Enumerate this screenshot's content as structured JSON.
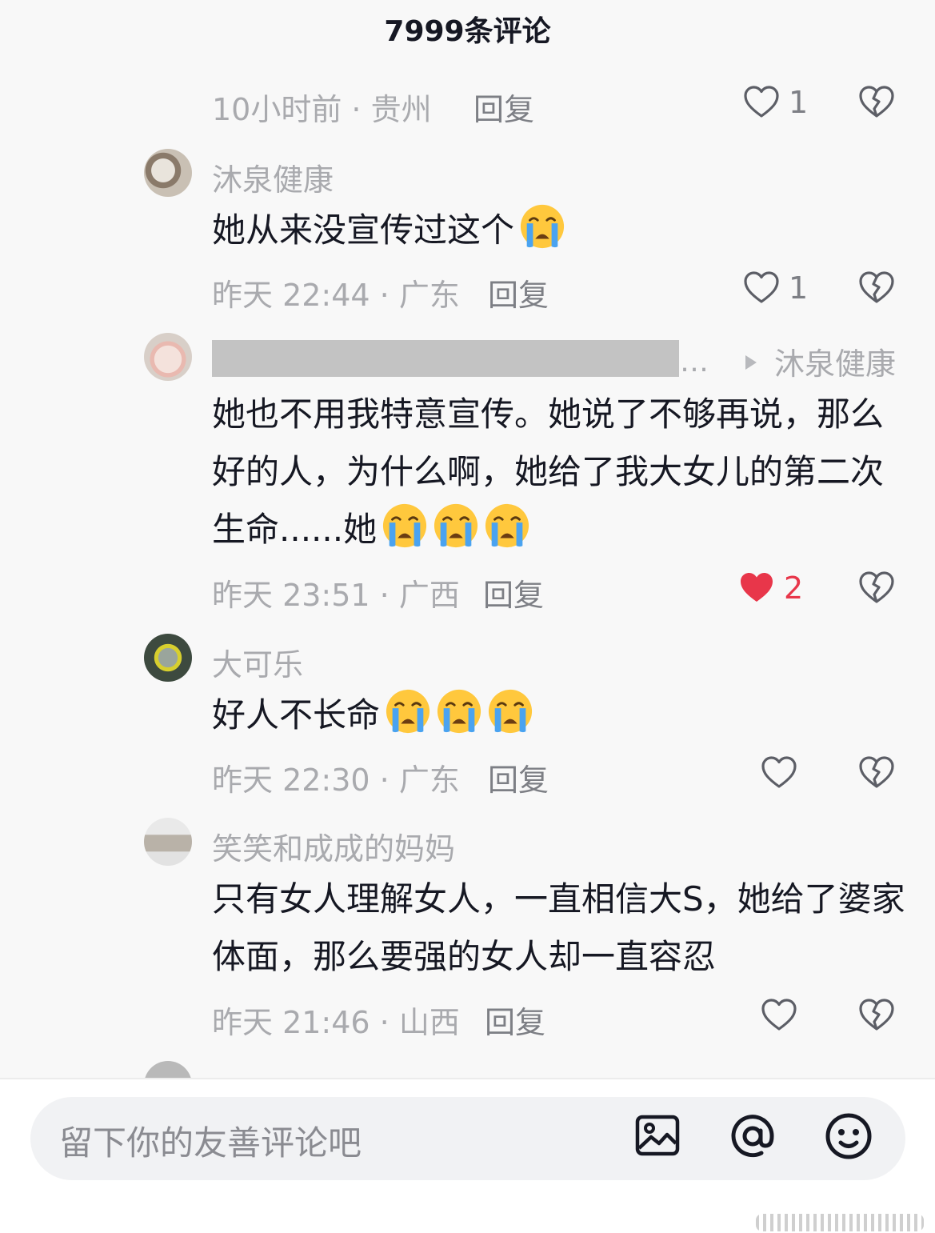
{
  "header": {
    "title": "7999条评论"
  },
  "top_meta": {
    "time_location": "10小时前 · 贵州",
    "reply_label": "回复",
    "likes": "1"
  },
  "comments": [
    {
      "username": "沐泉健康",
      "text": "她从来没宣传过这个",
      "time_location": "昨天 22:44 · 广东",
      "reply_label": "回复",
      "likes": "1",
      "liked": false,
      "emoji_count": 1
    },
    {
      "username": "",
      "reply_to": "沐泉健康",
      "text": "她也不用我特意宣传。她说了不够再说，那么好的人，为什么啊，她给了我大女儿的第二次生命......她",
      "time_location": "昨天 23:51 · 广西",
      "reply_label": "回复",
      "likes": "2",
      "liked": true,
      "emoji_count": 3
    },
    {
      "username": "大可乐",
      "text": "好人不长命",
      "time_location": "昨天 22:30 · 广东",
      "reply_label": "回复",
      "likes": "",
      "liked": false,
      "emoji_count": 3
    },
    {
      "username": "笑笑和成成的妈妈",
      "text": "只有女人理解女人，一直相信大S，她给了婆家体面，那么要强的女人却一直容忍",
      "time_location": "昨天 21:46 · 山西",
      "reply_label": "回复",
      "likes": "",
      "liked": false,
      "emoji_count": 0
    }
  ],
  "bottom_bar": {
    "placeholder": "留下你的友善评论吧",
    "icons": [
      "image-icon",
      "at-icon",
      "emoji-icon"
    ]
  },
  "colors": {
    "background": "#f8f8f8",
    "meta_gray": "#a9aaae",
    "like_red": "#e8364a",
    "text_dark": "#161823"
  }
}
